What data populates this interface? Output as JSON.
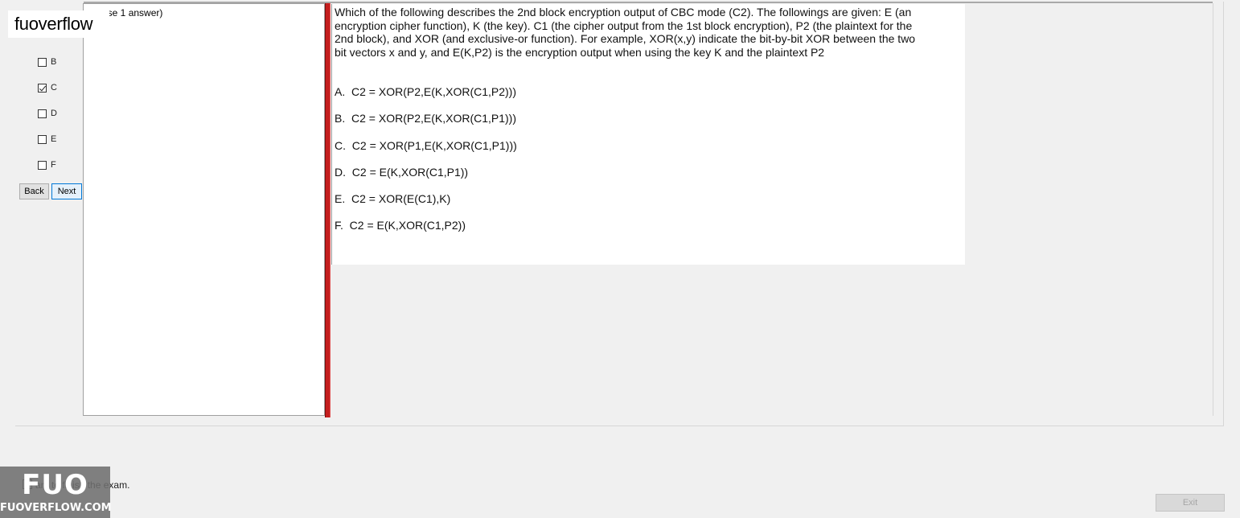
{
  "watermark": {
    "text": "fuoverflow"
  },
  "left_panel": {
    "checkboxes": [
      {
        "label": "B",
        "checked": false
      },
      {
        "label": "C",
        "checked": true
      },
      {
        "label": "D",
        "checked": false
      },
      {
        "label": "E",
        "checked": false
      },
      {
        "label": "F",
        "checked": false
      }
    ],
    "back_label": "Back",
    "next_label": "Next"
  },
  "answer_pane": {
    "instruction": "ose 1 answer)"
  },
  "question": {
    "text": "Which of the following describes the 2nd block encryption output of CBC mode (C2). The followings are given: E (an encryption cipher function), K (the key). C1 (the cipher output from the 1st block encryption), P2 (the plaintext for the 2nd block), and XOR (and exclusive-or function). For example, XOR(x,y) indicate the bit-by-bit XOR between the two bit vectors x and y, and E(K,P2) is the encryption output when using the key K and the plaintext P2",
    "options": [
      "A.  C2 = XOR(P2,E(K,XOR(C1,P2)))",
      "B.  C2 = XOR(P2,E(K,XOR(C1,P1)))",
      "C.  C2 = XOR(P1,E(K,XOR(C1,P1)))",
      "D.  C2 = E(K,XOR(C1,P1))",
      "E.  C2 = XOR(E(C1),K)",
      "F.  C2 = E(K,XOR(C1,P2))"
    ]
  },
  "footer": {
    "finish_label": "ant to finish the exam.",
    "exit_label": "Exit"
  },
  "logo": {
    "main": "FUO",
    "sub": "FUOVERFLOW.COM"
  }
}
